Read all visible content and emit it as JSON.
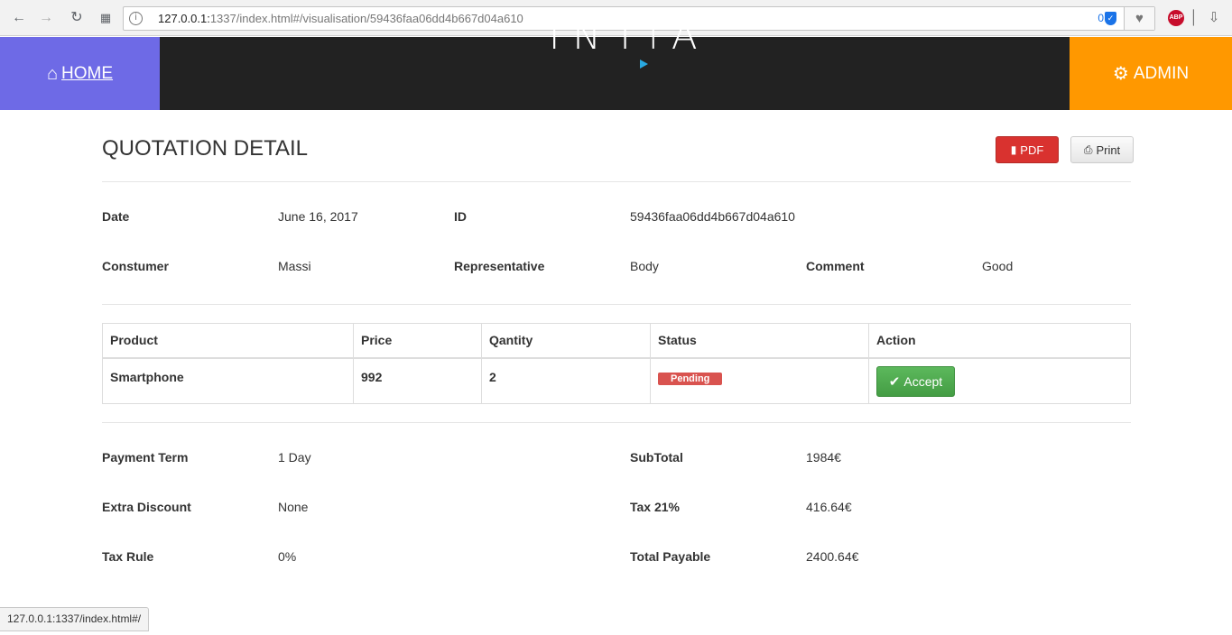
{
  "browser": {
    "url_host": "127.0.0.1:",
    "url_path": "1337/index.html#/visualisation/59436faa06dd4b667d04a610",
    "ext_count": "0",
    "abp_label": "ABP",
    "icons": [
      "back-icon",
      "forward-icon",
      "reload-icon",
      "apps-icon",
      "site-info-icon",
      "shield-icon",
      "heart-icon",
      "abp-icon",
      "extension-icon",
      "download-icon"
    ]
  },
  "navbar": {
    "home_label": "HOME",
    "brand": "INTiA",
    "admin_label": "ADMIN",
    "colors": {
      "home_bg": "#6e6ae6",
      "bar_bg": "#222222",
      "admin_bg": "#ff9800",
      "brand_accent": "#29a9e1"
    }
  },
  "page": {
    "title": "QUOTATION DETAIL",
    "pdf_label": "PDF",
    "print_label": "Print"
  },
  "details": {
    "date_label": "Date",
    "date_value": "June 16, 2017",
    "id_label": "ID",
    "id_value": "59436faa06dd4b667d04a610",
    "consumer_label": "Constumer",
    "consumer_value": "Massi",
    "representative_label": "Representative",
    "representative_value": "Body",
    "comment_label": "Comment",
    "comment_value": "Good"
  },
  "table": {
    "headers": [
      "Product",
      "Price",
      "Qantity",
      "Status",
      "Action"
    ],
    "rows": [
      {
        "product": "Smartphone",
        "price": "992",
        "quantity": "2",
        "status": "Pending",
        "action": "Accept"
      }
    ]
  },
  "summary": {
    "payment_term_label": "Payment Term",
    "payment_term_value": "1 Day",
    "extra_discount_label": "Extra Discount",
    "extra_discount_value": "None",
    "tax_rule_label": "Tax Rule",
    "tax_rule_value": "0%",
    "subtotal_label": "SubTotal",
    "subtotal_value": "1984€",
    "tax_label": "Tax 21%",
    "tax_value": "416.64€",
    "total_label": "Total Payable",
    "total_value": "2400.64€"
  },
  "status_bar": {
    "text": "127.0.0.1:1337/index.html#/"
  }
}
